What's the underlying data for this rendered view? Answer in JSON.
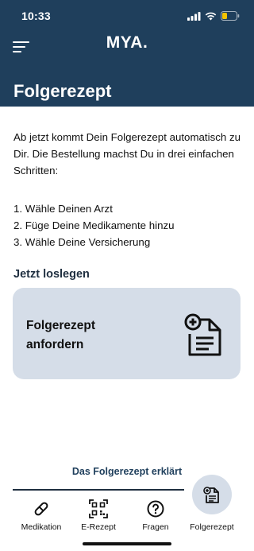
{
  "status_bar": {
    "time": "10:33"
  },
  "header": {
    "brand": "MYA.",
    "title": "Folgerezept"
  },
  "intro": "Ab jetzt kommt Dein Folgerezept automatisch zu Dir. Die Bestellung machst Du in drei einfachen Schritten:",
  "steps": [
    "1.  Wähle Deinen Arzt",
    "2.  Füge Deine Medikamente hinzu",
    "3.  Wähle Deine Versicherung"
  ],
  "section_heading": "Jetzt loslegen",
  "card": {
    "label": "Folgerezept anfordern",
    "icon": "prescription-add-icon"
  },
  "explain_link": "Das Folgerezept erklärt",
  "tabs": [
    {
      "label": "Medikation",
      "icon": "pill-icon"
    },
    {
      "label": "E-Rezept",
      "icon": "qr-code-icon"
    },
    {
      "label": "Fragen",
      "icon": "question-circle-icon"
    },
    {
      "label": "Folgerezept",
      "icon": "prescription-icon",
      "active": true
    }
  ],
  "colors": {
    "header_bg": "#1f3f5c",
    "card_bg": "#d5dde8",
    "battery": "#f5c400"
  }
}
